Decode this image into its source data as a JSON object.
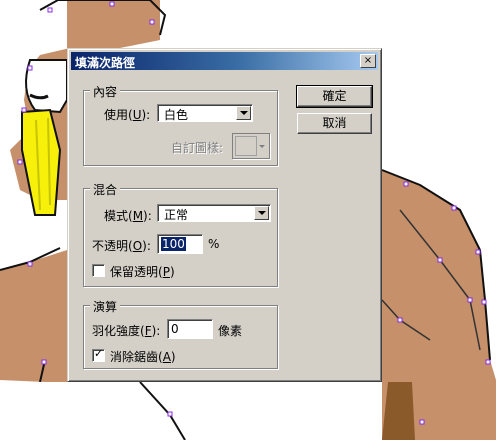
{
  "dialog": {
    "title": "填滿次路徑",
    "close_glyph": "×"
  },
  "contents_group": {
    "title": "內容",
    "use_label_prefix": "使用(",
    "use_label_key": "U",
    "use_label_suffix": "):",
    "use_value": "白色",
    "custom_pattern_label": "自訂圖樣:"
  },
  "blending_group": {
    "title": "混合",
    "mode_label_prefix": "模式(",
    "mode_label_key": "M",
    "mode_label_suffix": "):",
    "mode_value": "正常",
    "opacity_label_prefix": "不透明(",
    "opacity_label_key": "O",
    "opacity_label_suffix": "):",
    "opacity_value": "100",
    "opacity_unit": "%",
    "preserve_transparency_prefix": "保留透明(",
    "preserve_transparency_key": "P",
    "preserve_transparency_suffix": ")",
    "preserve_transparency_checked": false
  },
  "rendering_group": {
    "title": "演算",
    "feather_label_prefix": "羽化強度(",
    "feather_label_key": "F",
    "feather_label_suffix": "):",
    "feather_value": "0",
    "feather_unit": "像素",
    "antialias_prefix": "消除鋸齒(",
    "antialias_key": "A",
    "antialias_suffix": ")",
    "antialias_checked": true,
    "check_glyph": "✓"
  },
  "buttons": {
    "ok": "確定",
    "cancel": "取消"
  },
  "colors": {
    "dialog_face": "#d4d0c8",
    "title_gradient_start": "#0a246a",
    "fur": "#c6906a",
    "collar": "#f6f00a",
    "anchor_points": "#8a2be2"
  }
}
